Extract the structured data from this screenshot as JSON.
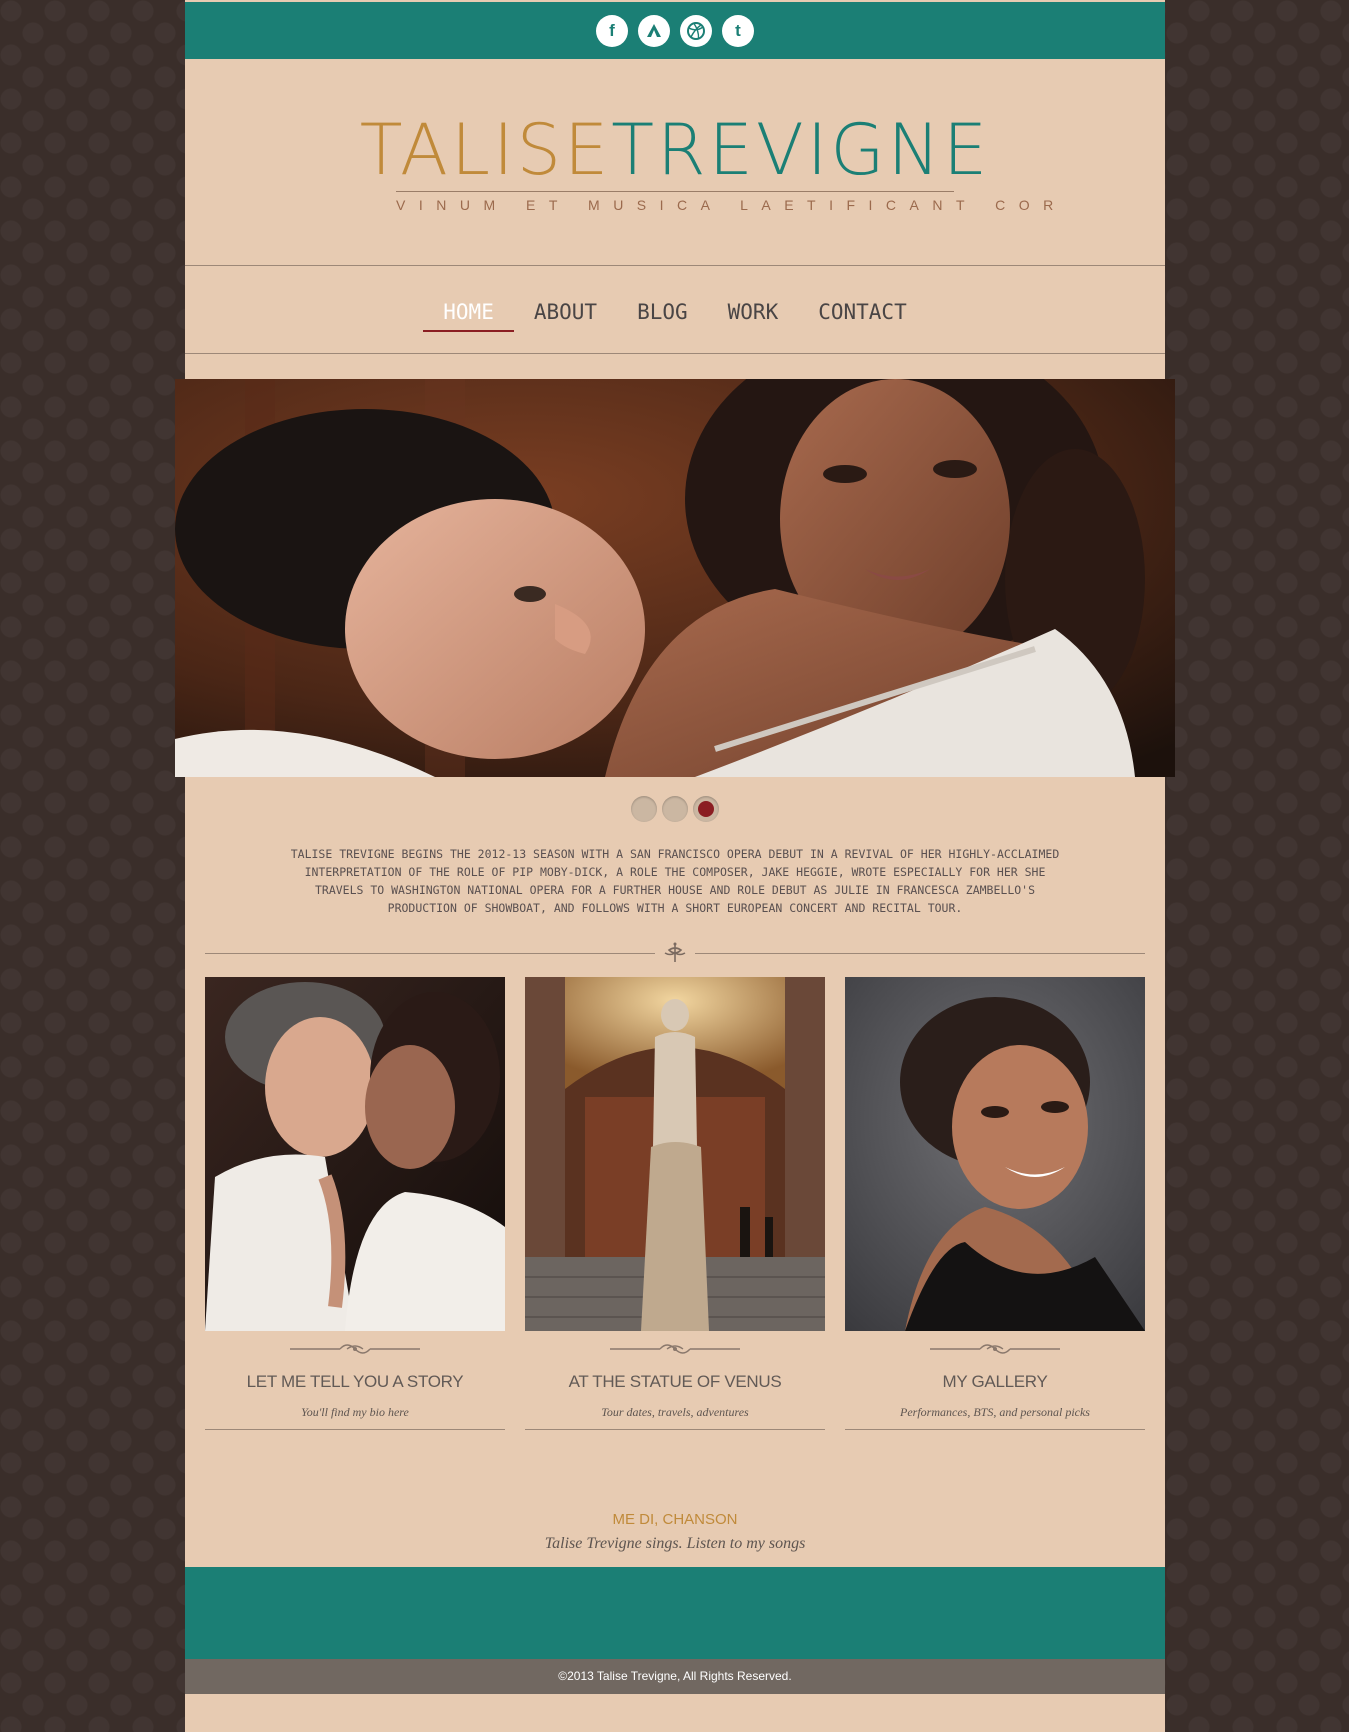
{
  "social": {
    "facebook": "f",
    "twitter": "t",
    "icons": [
      "facebook-icon",
      "campsite-icon",
      "dribbble-icon",
      "twitter-icon"
    ]
  },
  "logo": {
    "first": "TALISE",
    "last": "TREVIGNE",
    "tagline": "VINUM ET MUSICA LAETIFICANT COR"
  },
  "nav": {
    "items": [
      {
        "label": "HOME",
        "active": true
      },
      {
        "label": "ABOUT"
      },
      {
        "label": "BLOG"
      },
      {
        "label": "WORK"
      },
      {
        "label": "CONTACT"
      }
    ]
  },
  "slider": {
    "slides": 3,
    "active_index": 2
  },
  "intro": "TALISE TREVIGNE BEGINS THE 2012-13 SEASON WITH A SAN FRANCISCO OPERA DEBUT IN A REVIVAL OF HER HIGHLY-ACCLAIMED INTERPRETATION OF THE ROLE OF PIP MOBY-DICK, A ROLE THE COMPOSER, JAKE HEGGIE, WROTE ESPECIALLY FOR HER SHE TRAVELS TO WASHINGTON NATIONAL OPERA FOR A FURTHER HOUSE AND ROLE DEBUT AS JULIE IN FRANCESCA ZAMBELLO'S PRODUCTION OF SHOWBOAT, AND FOLLOWS WITH A SHORT EUROPEAN CONCERT AND RECITAL TOUR.",
  "cards": [
    {
      "title": "LET ME TELL YOU A STORY",
      "subtitle": "You'll find my bio here"
    },
    {
      "title": "AT THE STATUE OF VENUS",
      "subtitle": "Tour dates, travels, adventures"
    },
    {
      "title": "MY GALLERY",
      "subtitle": "Performances, BTS, and personal picks"
    }
  ],
  "feature": {
    "title": "ME DI, CHANSON",
    "subtitle": "Talise Trevigne sings. Listen to my songs"
  },
  "footer": {
    "copyright": "©2013 Talise Trevigne, All Rights Reserved."
  },
  "colors": {
    "teal": "#1b7f75",
    "gold": "#c08a3a",
    "crimson": "#8b1e22",
    "page": "#e7cbb2",
    "background": "#3a2e2a"
  }
}
